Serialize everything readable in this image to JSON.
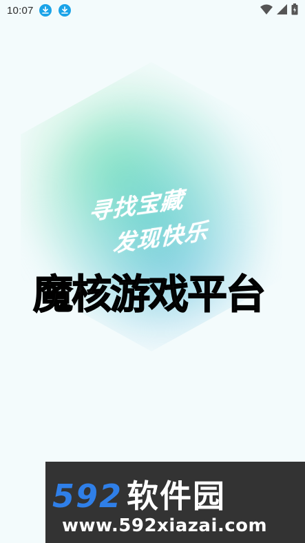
{
  "status_bar": {
    "time": "10:07",
    "icons_left": [
      "download-icon",
      "download-icon"
    ],
    "icons_right": [
      "wifi-icon",
      "signal-icon",
      "battery-icon"
    ]
  },
  "splash": {
    "tagline_line1": "寻找宝藏",
    "tagline_line2": "发现快乐",
    "title": "魔核游戏平台"
  },
  "watermark": {
    "brand_number": "592",
    "brand_text": "软件园",
    "url": "www.592xiazai.com"
  },
  "colors": {
    "background": "#f3fbfc",
    "download_icon": "#1aa3e8",
    "glow_green": "#78e6aa",
    "glow_blue": "#78bee b",
    "watermark_bg": "#333333",
    "watermark_blue": "#2f7fe8"
  }
}
